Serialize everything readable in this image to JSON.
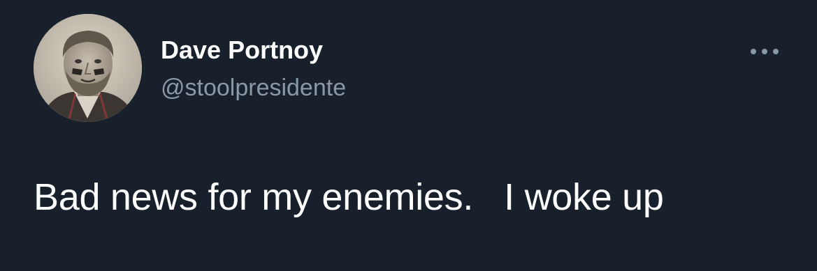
{
  "author": {
    "display_name": "Dave Portnoy",
    "handle": "@stoolpresidente"
  },
  "tweet": {
    "text": "Bad news for my enemies.   I woke up"
  },
  "icons": {
    "more": "more-horizontal-icon",
    "avatar": "profile-photo"
  },
  "colors": {
    "background": "#18202b",
    "primary_text": "#ffffff",
    "secondary_text": "#8b98a5"
  }
}
